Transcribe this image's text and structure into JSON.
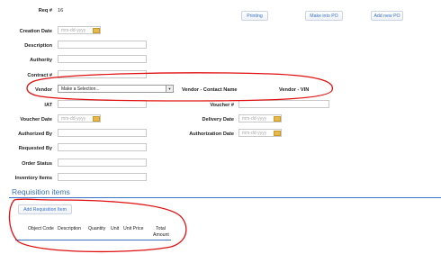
{
  "header": {
    "req_label": "Req #",
    "req_value": "16",
    "buttons": {
      "printing": "Printing",
      "make_into_po": "Make into PO",
      "add_new_po": "Add new PO"
    }
  },
  "form": {
    "creation_date_label": "Creation Date",
    "date_placeholder": "mm-dd-yyyy",
    "description_label": "Description",
    "authority_label": "Authority",
    "contract_label": "Contract #",
    "vendor_label": "Vendor",
    "vendor_select_value": "Make a Selection...",
    "vendor_contact_label": "Vendor - Contact Name",
    "vendor_vin_label": "Vendor - VIN",
    "iat_label": "IAT",
    "voucher_label": "Voucher #",
    "voucher_date_label": "Voucher Date",
    "delivery_date_label": "Delivery Date",
    "authorized_by_label": "Authorized By",
    "authorization_date_label": "Authorization Date",
    "requested_by_label": "Requested By",
    "order_status_label": "Order Status",
    "inventory_items_label": "Inventory Items"
  },
  "items": {
    "heading": "Requisition items",
    "add_button": "Add Requisition Item",
    "columns": [
      "Object Code",
      "Description",
      "Quantity",
      "Unit",
      "Unit Price",
      "Total",
      "Amount"
    ]
  },
  "colors": {
    "accent": "#3a72c4",
    "annotation": "#e01010",
    "date_button": "#e8b84a"
  }
}
